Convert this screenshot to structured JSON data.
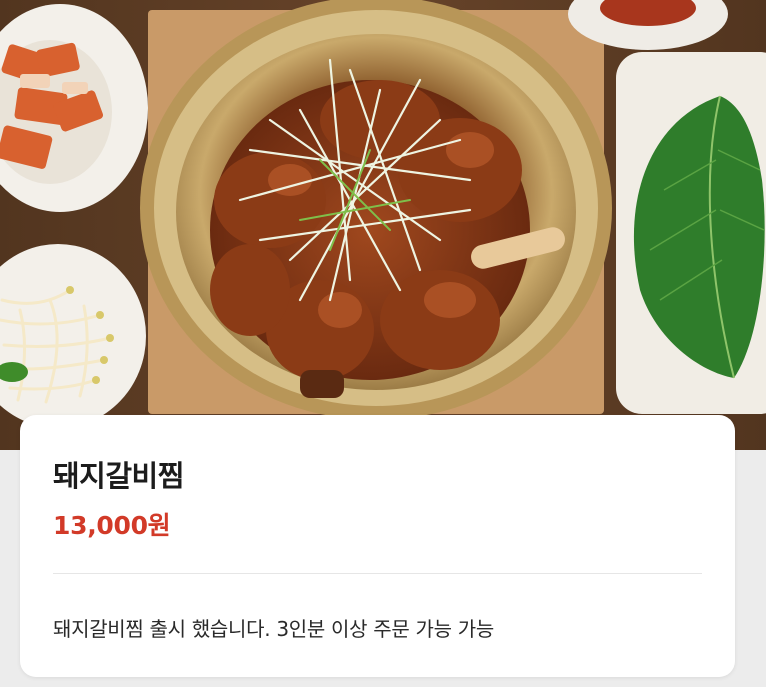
{
  "menu_item": {
    "title": "돼지갈비찜",
    "price": "13,000원",
    "description": "돼지갈비찜 출시 했습니다. 3인분 이상 주문 가능 가능"
  },
  "photo": {
    "subject": "braised pork ribs in brass pot with side dishes"
  },
  "colors": {
    "price": "#d23a28",
    "card": "#ffffff",
    "background": "#ececec"
  }
}
